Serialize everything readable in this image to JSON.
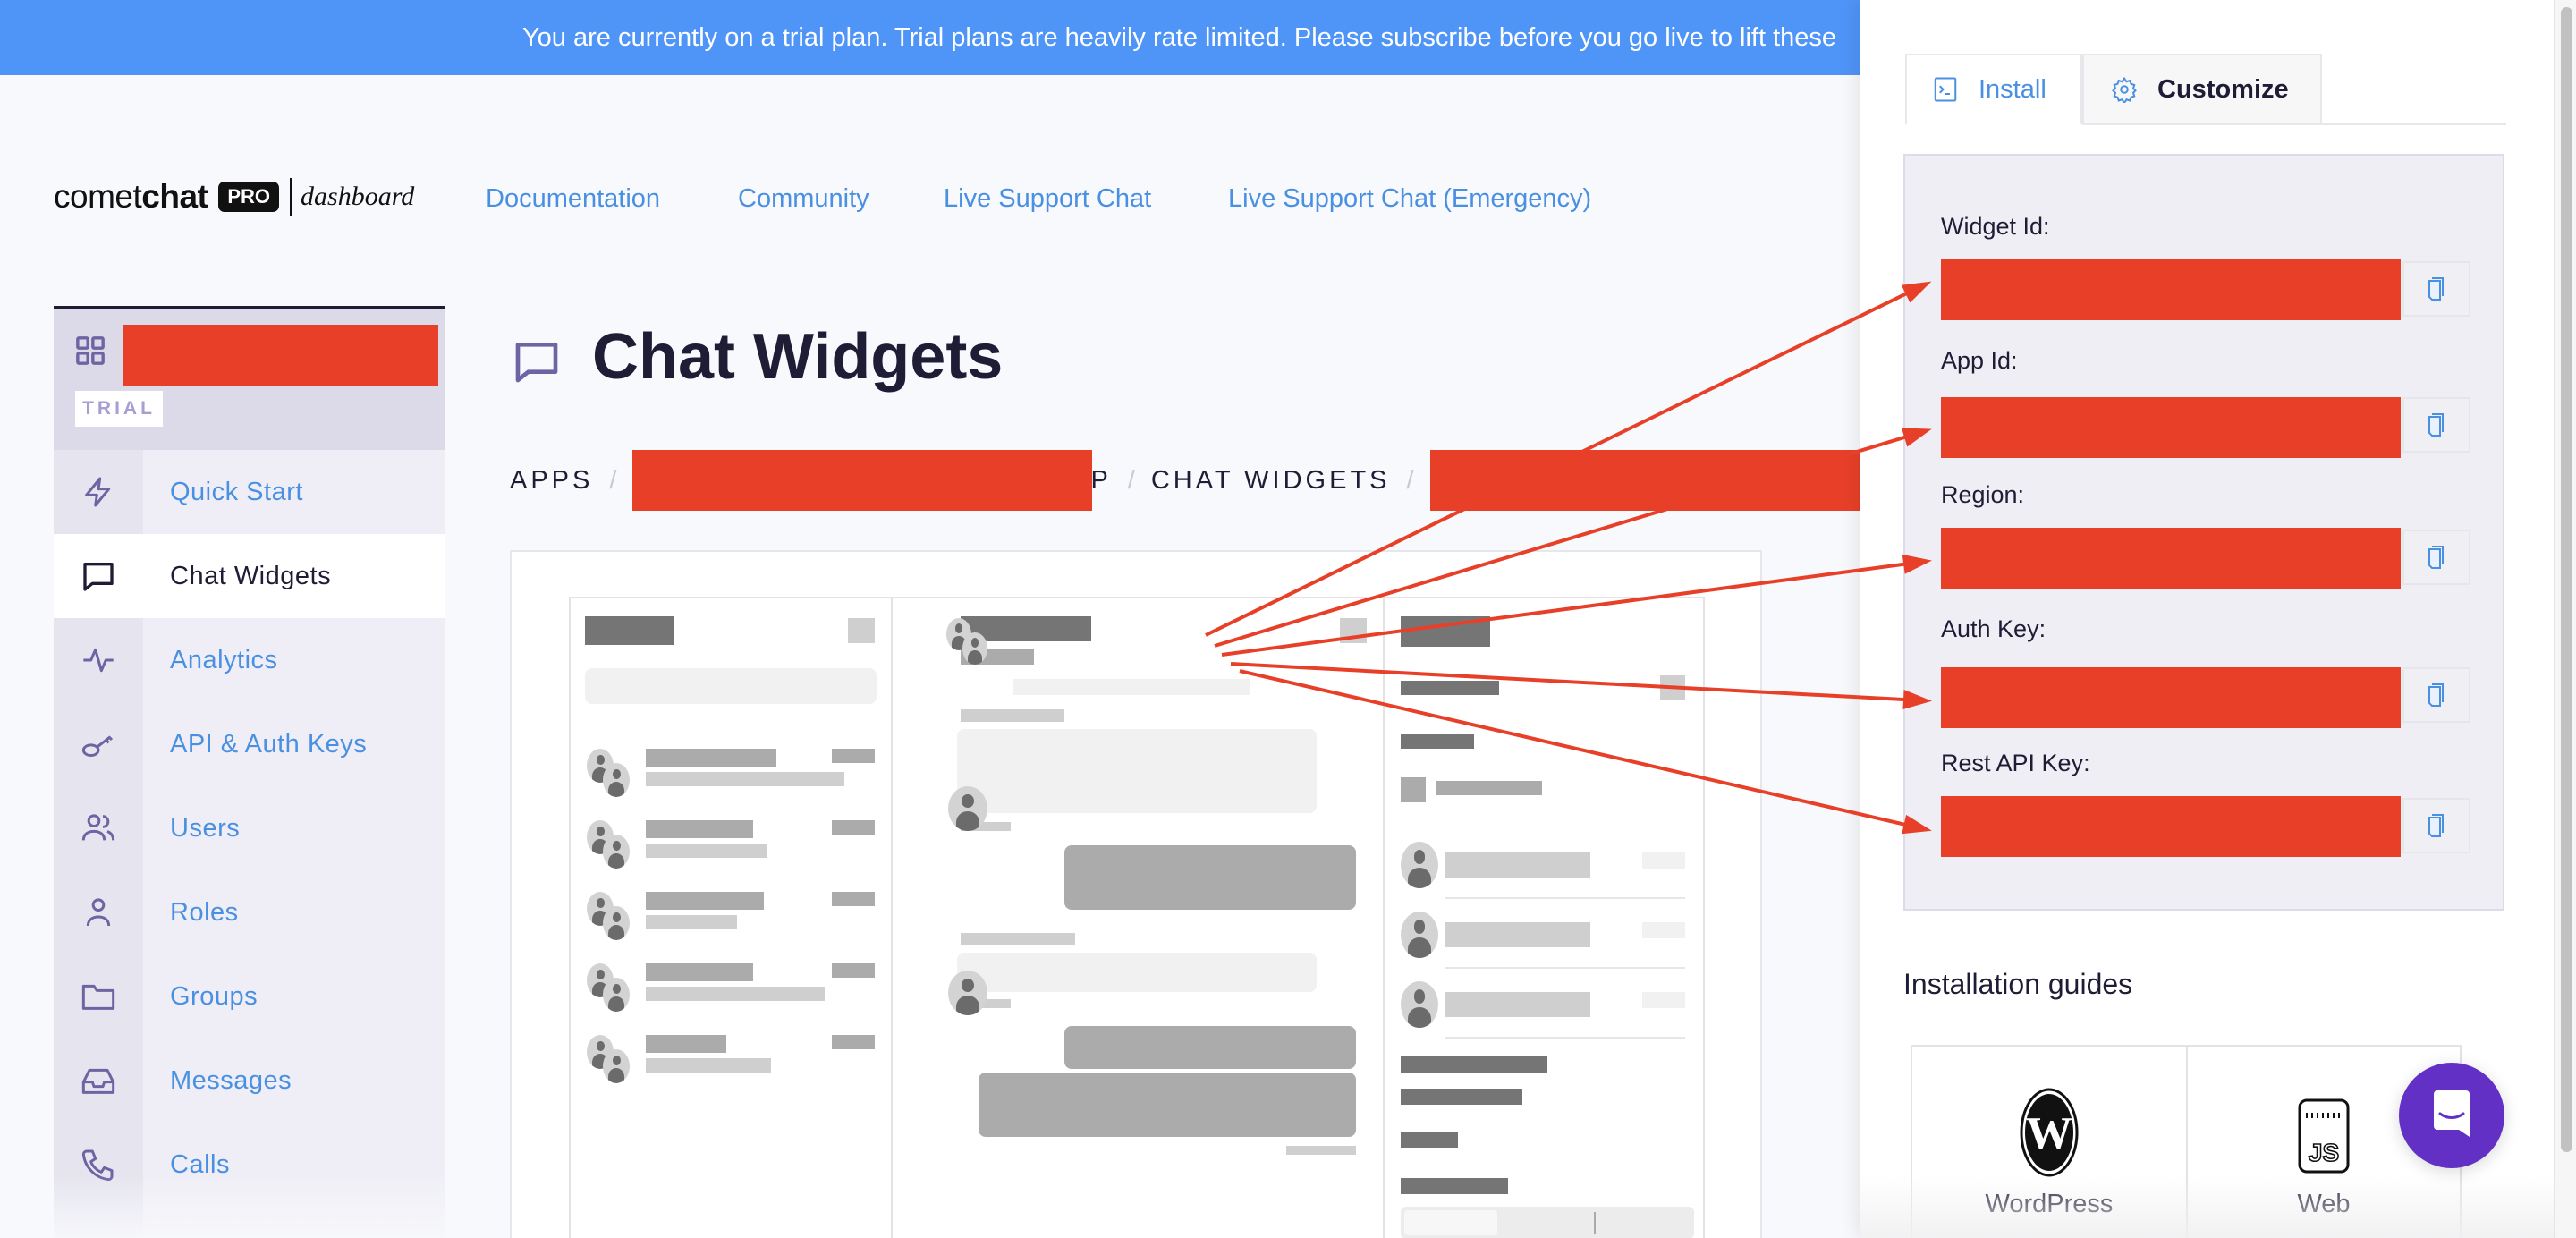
{
  "banner": {
    "text": "You are currently on a trial plan. Trial plans are heavily rate limited. Please subscribe before you go live to lift these"
  },
  "logo": {
    "comet": "comet",
    "chat": "chat",
    "badge": "PRO",
    "suffix": "dashboard"
  },
  "topnav": [
    {
      "label": "Documentation"
    },
    {
      "label": "Community"
    },
    {
      "label": "Live Support Chat"
    },
    {
      "label": "Live Support Chat (Emergency)"
    }
  ],
  "sidebar": {
    "app_switcher_icon": "grid-icon",
    "app_name": "[redacted]",
    "plan_badge": "TRIAL",
    "items": [
      {
        "label": "Quick Start",
        "icon": "lightning-icon",
        "active": false
      },
      {
        "label": "Chat Widgets",
        "icon": "chat-bubble-icon",
        "active": true
      },
      {
        "label": "Analytics",
        "icon": "activity-icon",
        "active": false
      },
      {
        "label": "API & Auth Keys",
        "icon": "key-icon",
        "active": false
      },
      {
        "label": "Users",
        "icon": "users-icon",
        "active": false
      },
      {
        "label": "Roles",
        "icon": "user-icon",
        "active": false
      },
      {
        "label": "Groups",
        "icon": "folder-icon",
        "active": false
      },
      {
        "label": "Messages",
        "icon": "inbox-icon",
        "active": false
      },
      {
        "label": "Calls",
        "icon": "phone-icon",
        "active": false
      }
    ]
  },
  "page": {
    "title": "Chat Widgets",
    "title_icon": "chat-bubble-icon",
    "breadcrumb": [
      {
        "label": "APPS"
      },
      {
        "label": "[redacted]",
        "redacted": true,
        "visible_tail": "P"
      },
      {
        "label": "CHAT WIDGETS"
      },
      {
        "label": "[redacted]",
        "redacted": true
      }
    ]
  },
  "panel": {
    "tabs": [
      {
        "label": "Install",
        "icon": "terminal-icon",
        "active": true
      },
      {
        "label": "Customize",
        "icon": "gear-icon",
        "active": false
      }
    ],
    "fields": [
      {
        "label": "Widget Id:",
        "value": "[redacted]"
      },
      {
        "label": "App Id:",
        "value": "[redacted]"
      },
      {
        "label": "Region:",
        "value": "[redacted]"
      },
      {
        "label": "Auth Key:",
        "value": "[redacted]"
      },
      {
        "label": "Rest API Key:",
        "value": "[redacted]"
      }
    ],
    "copy_icon": "copy-icon",
    "guides_title": "Installation guides",
    "guides": [
      {
        "label": "WordPress",
        "icon": "wordpress-icon"
      },
      {
        "label": "Web",
        "icon": "javascript-icon"
      }
    ],
    "launcher_icon": "chat-launcher-icon"
  },
  "colors": {
    "banner": "#4f94f7",
    "link": "#4a90e2",
    "redaction": "#e84028",
    "annotation_arrow": "#e84028",
    "launcher": "#6230c5",
    "sidebar_icon": "#6e64a3"
  }
}
